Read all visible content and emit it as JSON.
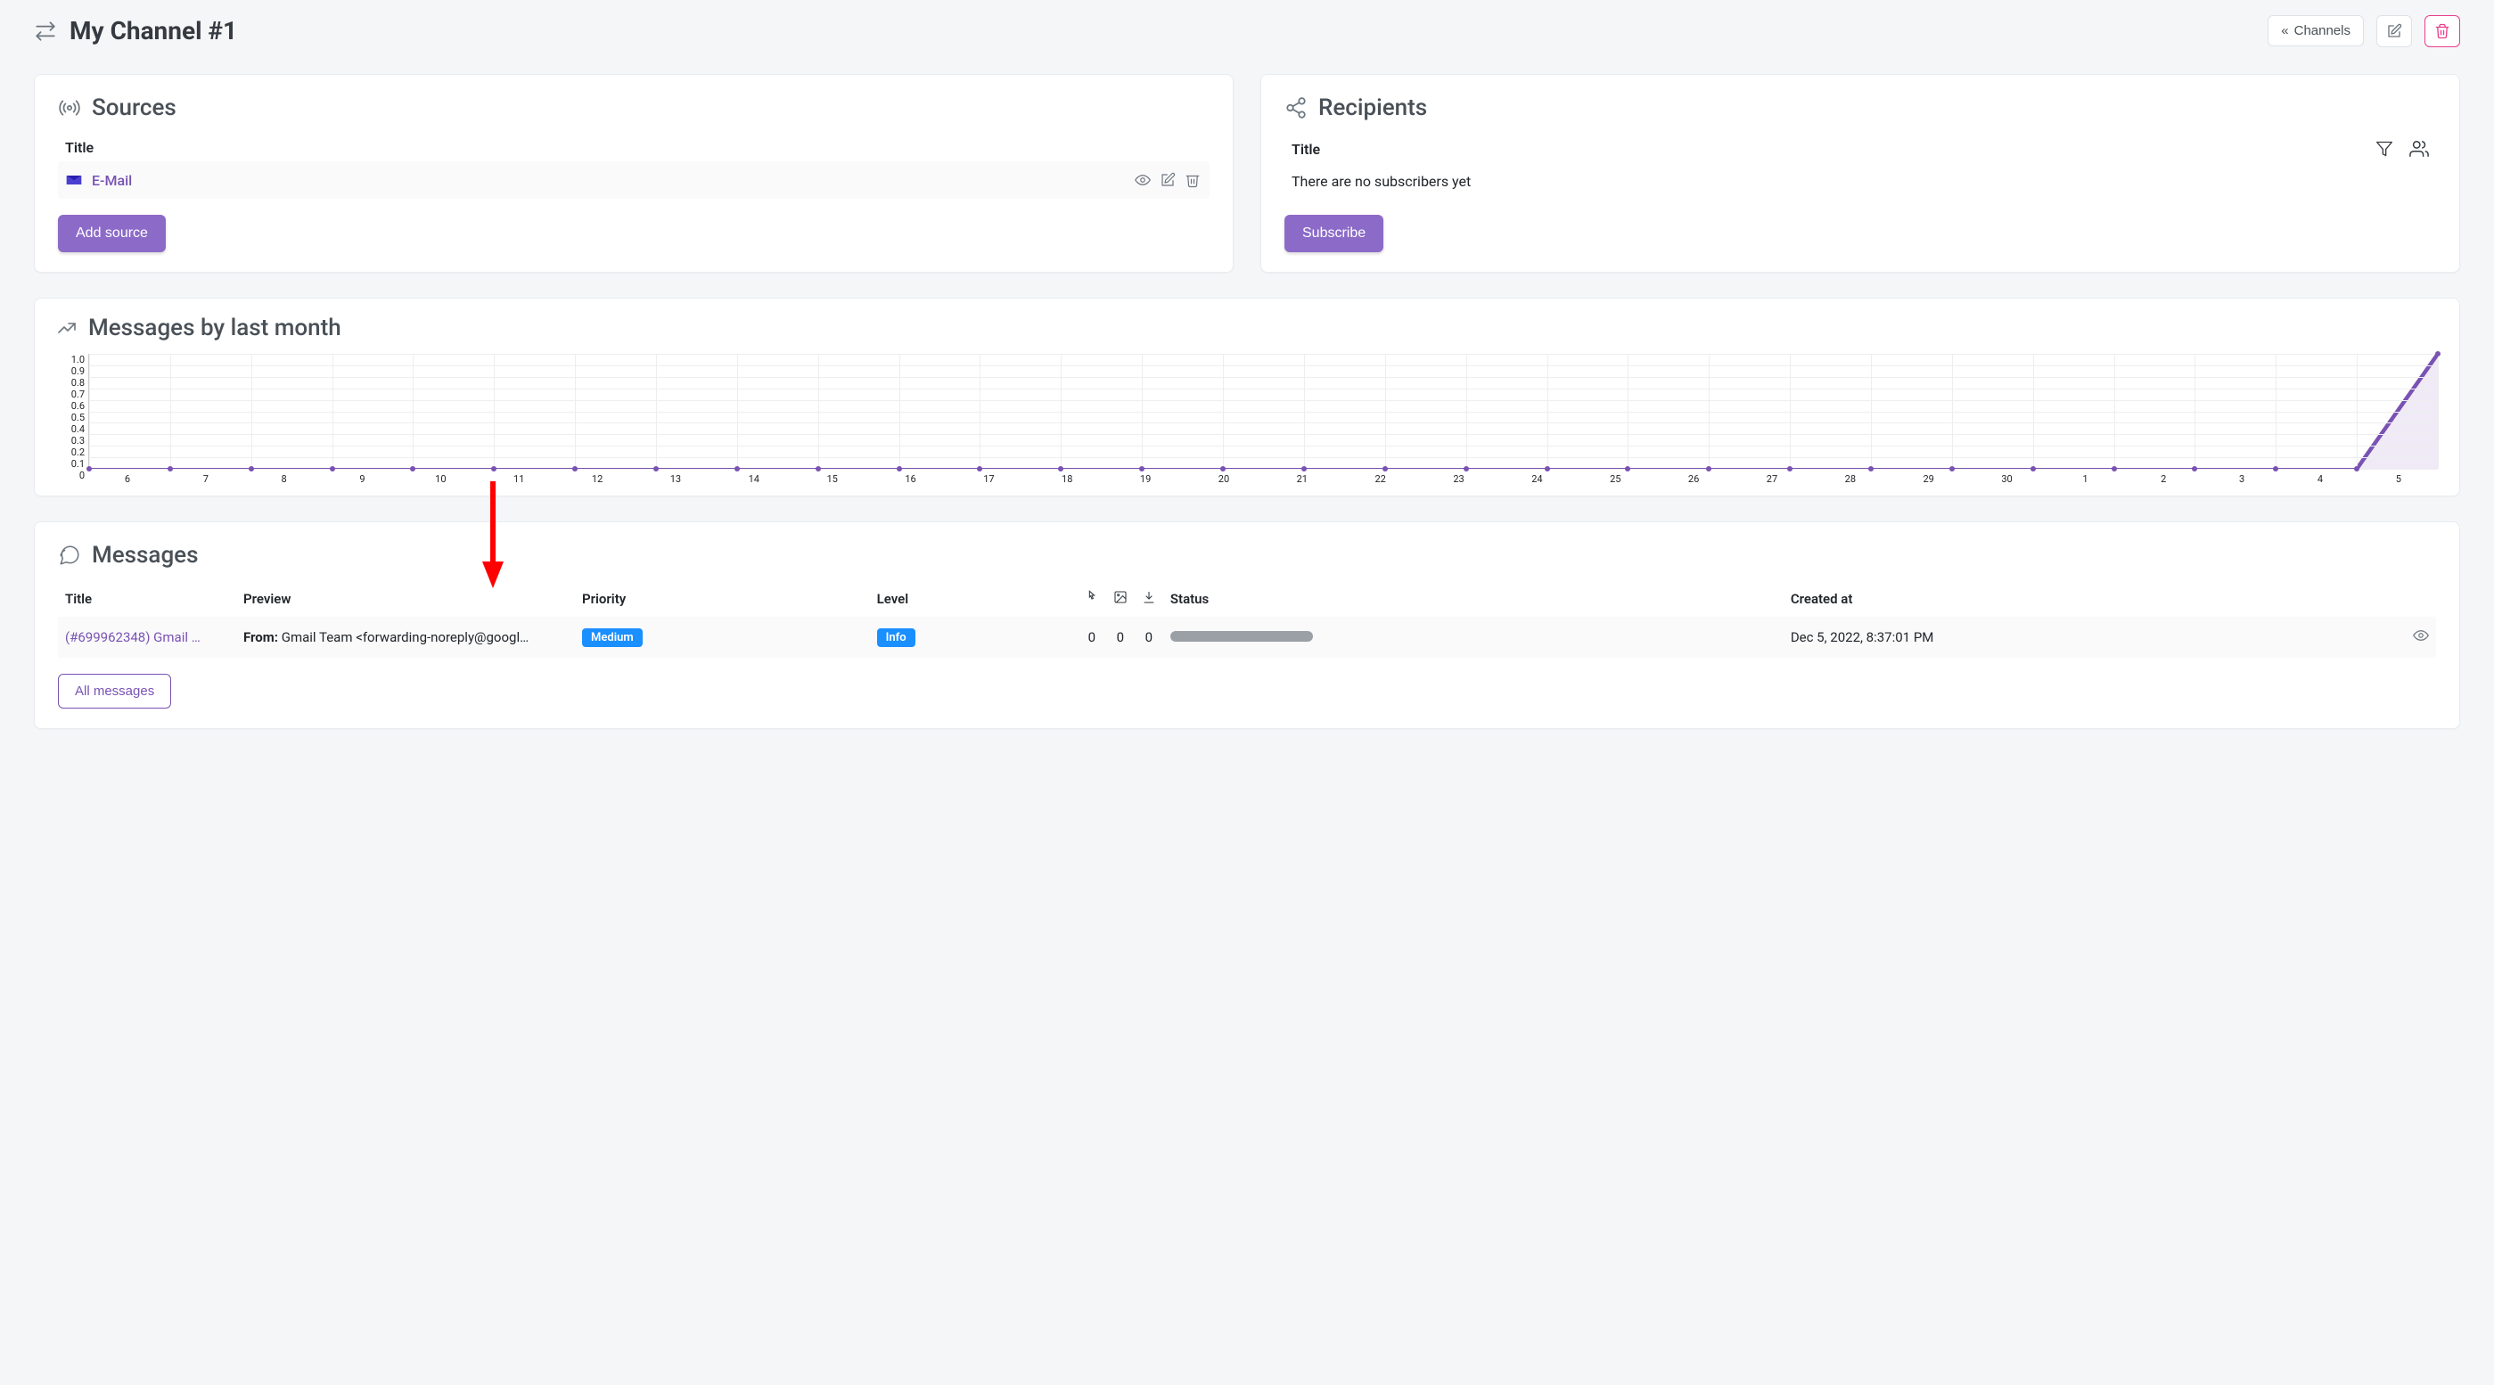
{
  "header": {
    "title": "My Channel #1",
    "channels_btn": "Channels"
  },
  "sources": {
    "title": "Sources",
    "th_title": "Title",
    "items": [
      {
        "label": "E-Mail"
      }
    ],
    "add_btn": "Add source"
  },
  "recipients": {
    "title": "Recipients",
    "th_title": "Title",
    "empty_text": "There are no subscribers yet",
    "subscribe_btn": "Subscribe"
  },
  "chart": {
    "title": "Messages by last month"
  },
  "chart_data": {
    "type": "line",
    "title": "Messages by last month",
    "xlabel": "",
    "ylabel": "",
    "ylim": [
      0,
      1.0
    ],
    "y_ticks": [
      "1.0",
      "0.9",
      "0.8",
      "0.7",
      "0.6",
      "0.5",
      "0.4",
      "0.3",
      "0.2",
      "0.1",
      "0"
    ],
    "categories": [
      "6",
      "7",
      "8",
      "9",
      "10",
      "11",
      "12",
      "13",
      "14",
      "15",
      "16",
      "17",
      "18",
      "19",
      "20",
      "21",
      "22",
      "23",
      "24",
      "25",
      "26",
      "27",
      "28",
      "29",
      "30",
      "1",
      "2",
      "3",
      "4",
      "5"
    ],
    "values": [
      0,
      0,
      0,
      0,
      0,
      0,
      0,
      0,
      0,
      0,
      0,
      0,
      0,
      0,
      0,
      0,
      0,
      0,
      0,
      0,
      0,
      0,
      0,
      0,
      0,
      0,
      0,
      0,
      0,
      1
    ]
  },
  "messages": {
    "title": "Messages",
    "columns": {
      "title": "Title",
      "preview": "Preview",
      "priority": "Priority",
      "level": "Level",
      "status": "Status",
      "created": "Created at"
    },
    "rows": [
      {
        "title": "(#699962348) Gmail …",
        "preview_label": "From:",
        "preview_value": "Gmail Team <forwarding-noreply@googl…",
        "priority": "Medium",
        "level": "Info",
        "clicks": "0",
        "images": "0",
        "downloads": "0",
        "created": "Dec 5, 2022, 8:37:01 PM"
      }
    ],
    "all_btn": "All messages"
  }
}
